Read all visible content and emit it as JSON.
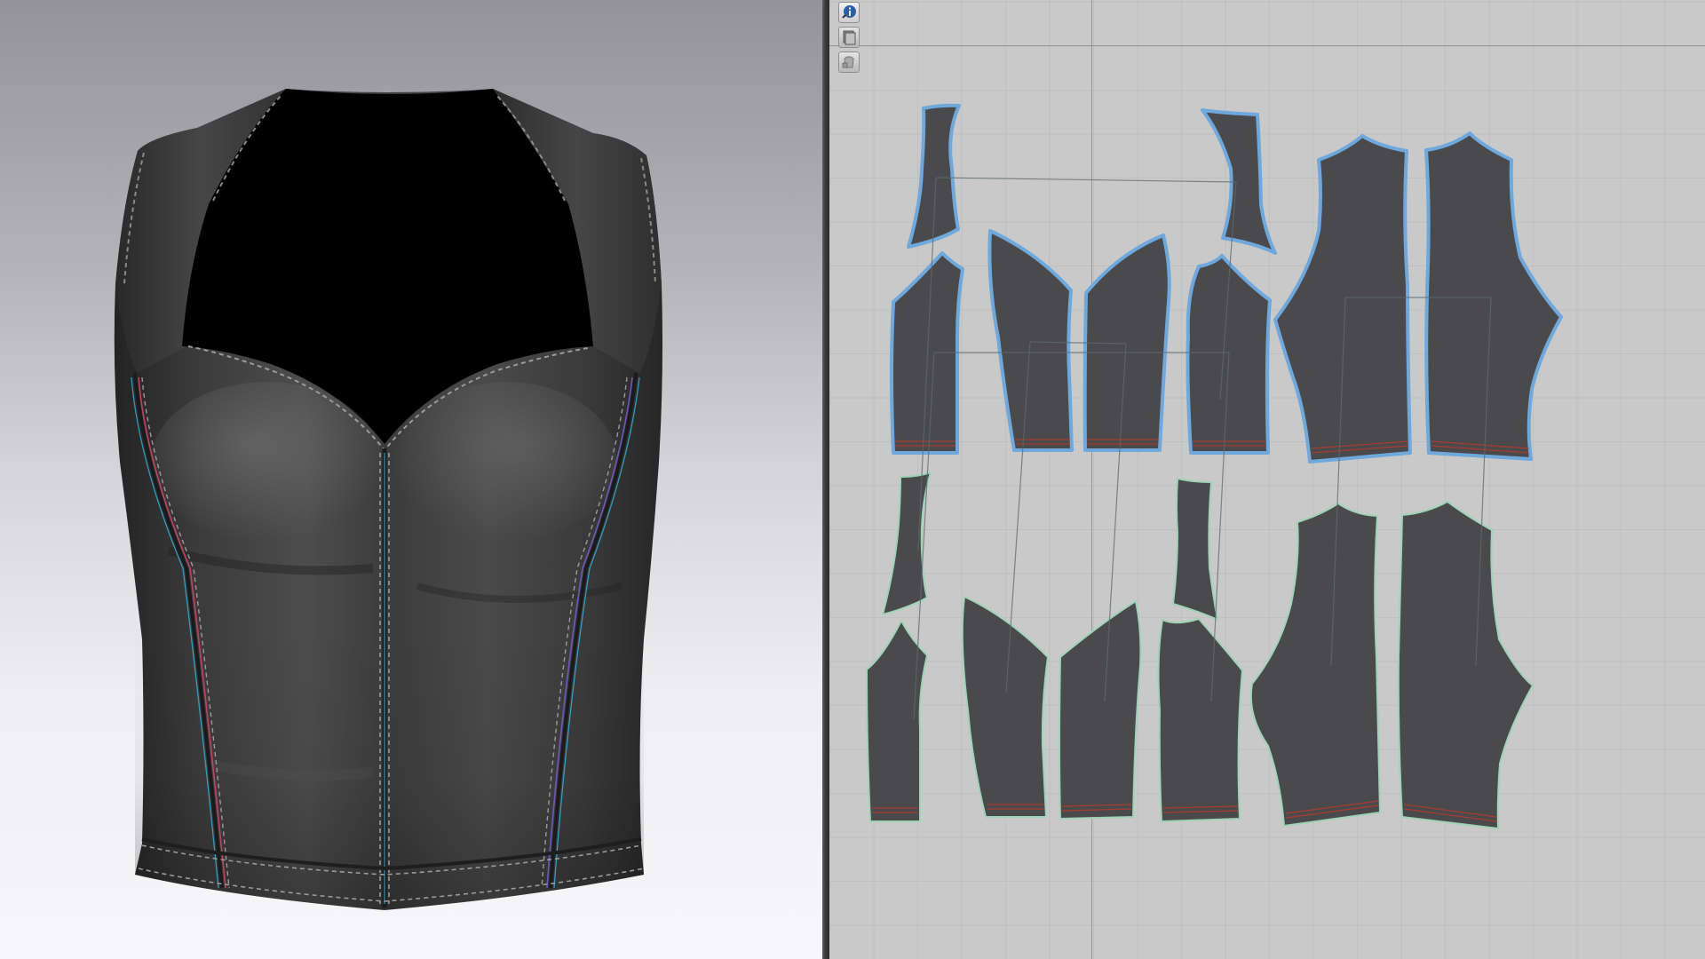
{
  "window": {
    "views": [
      "3d-garment-view",
      "2d-pattern-view"
    ]
  },
  "toolbar_2d": {
    "tools": [
      {
        "icon": "info-icon",
        "active": true
      },
      {
        "icon": "pattern-layers-icon",
        "active": false
      },
      {
        "icon": "garment-lock-icon",
        "active": false
      }
    ]
  },
  "garment": {
    "type": "sleeveless sweetheart corset top",
    "material_color": "#3a3a3a",
    "inner_color": "#000000",
    "topstitch_color": "#9a9a9a",
    "seam_colors": [
      "#d9456b",
      "#2fb7e0",
      "#7b5cd6"
    ]
  },
  "pattern": {
    "piece_fill": "#4a4a4c",
    "selected_outline_color": "#6fa8dc",
    "unselected_outline_color": "#9fd3b5",
    "hem_line_color": "#c0392b",
    "grainline_color": "#5d6a6e",
    "selected_piece_count": 10,
    "unselected_piece_count": 10
  },
  "colors": {
    "background_2d": "#c9c9c9",
    "splitter": "#3a3a3a"
  }
}
